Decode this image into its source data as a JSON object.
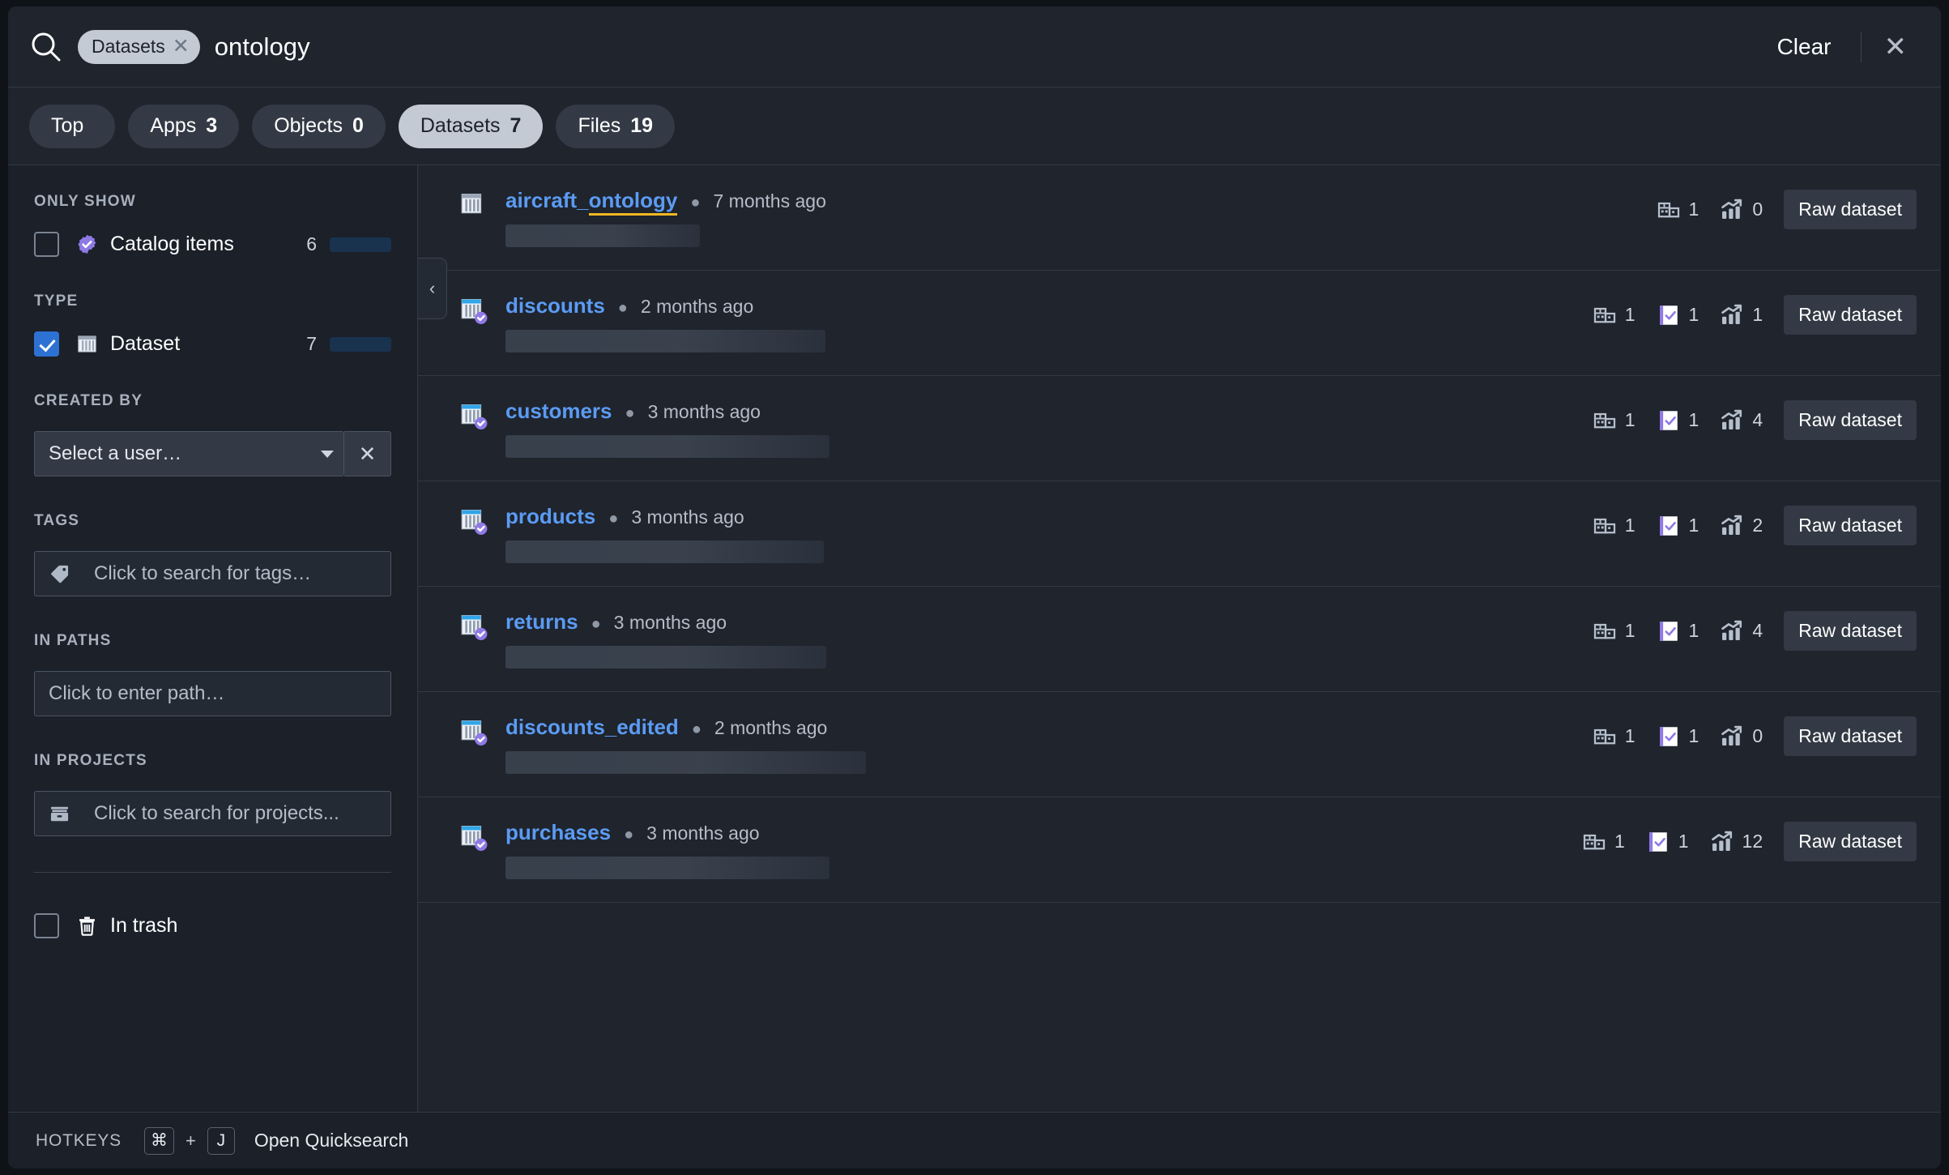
{
  "search": {
    "scope_chip": "Datasets",
    "query": "ontology",
    "clear_label": "Clear",
    "close_label": "✕"
  },
  "tabs": [
    {
      "label": "Top",
      "count": "",
      "active": false
    },
    {
      "label": "Apps",
      "count": "3",
      "active": false
    },
    {
      "label": "Objects",
      "count": "0",
      "active": false
    },
    {
      "label": "Datasets",
      "count": "7",
      "active": true
    },
    {
      "label": "Files",
      "count": "19",
      "active": false
    }
  ],
  "sidebar": {
    "only_show_label": "ONLY SHOW",
    "only_show": {
      "name": "Catalog items",
      "count": "6",
      "bar_pct": 86,
      "checked": false,
      "icon": "catalog-check-icon"
    },
    "type_label": "TYPE",
    "type": {
      "name": "Dataset",
      "count": "7",
      "bar_pct": 100,
      "checked": true,
      "icon": "dataset-icon"
    },
    "created_by_label": "CREATED BY",
    "created_by_placeholder": "Select a user…",
    "tags_label": "TAGS",
    "tags_placeholder": "Click to search for tags…",
    "in_paths_label": "IN PATHS",
    "in_paths_placeholder": "Click to enter path…",
    "in_projects_label": "IN PROJECTS",
    "in_projects_placeholder": "Click to search for projects...",
    "in_trash_label": "In trash",
    "in_trash_checked": false,
    "collapse_glyph": "‹"
  },
  "results": [
    {
      "title": "aircraft_",
      "title_highlight": "ontology",
      "time": "7 months ago",
      "verified": false,
      "skeleton_width": 240,
      "org_count": "1",
      "checks_count": null,
      "charts_count": "0",
      "raw_label": "Raw dataset"
    },
    {
      "title": "discounts",
      "title_highlight": "",
      "time": "2 months ago",
      "verified": true,
      "skeleton_width": 395,
      "org_count": "1",
      "checks_count": "1",
      "charts_count": "1",
      "raw_label": "Raw dataset"
    },
    {
      "title": "customers",
      "title_highlight": "",
      "time": "3 months ago",
      "verified": true,
      "skeleton_width": 400,
      "org_count": "1",
      "checks_count": "1",
      "charts_count": "4",
      "raw_label": "Raw dataset"
    },
    {
      "title": "products",
      "title_highlight": "",
      "time": "3 months ago",
      "verified": true,
      "skeleton_width": 393,
      "org_count": "1",
      "checks_count": "1",
      "charts_count": "2",
      "raw_label": "Raw dataset"
    },
    {
      "title": "returns",
      "title_highlight": "",
      "time": "3 months ago",
      "verified": true,
      "skeleton_width": 396,
      "org_count": "1",
      "checks_count": "1",
      "charts_count": "4",
      "raw_label": "Raw dataset"
    },
    {
      "title": "discounts_edited",
      "title_highlight": "",
      "time": "2 months ago",
      "verified": true,
      "skeleton_width": 445,
      "org_count": "1",
      "checks_count": "1",
      "charts_count": "0",
      "raw_label": "Raw dataset"
    },
    {
      "title": "purchases",
      "title_highlight": "",
      "time": "3 months ago",
      "verified": true,
      "skeleton_width": 400,
      "org_count": "1",
      "checks_count": "1",
      "charts_count": "12",
      "raw_label": "Raw dataset"
    }
  ],
  "hotkeys": {
    "label": "HOTKEYS",
    "key1": "⌘",
    "plus": "+",
    "key2": "J",
    "description": "Open Quicksearch"
  },
  "colors": {
    "accent_blue": "#2d72d2",
    "link_blue": "#5b9bf3",
    "highlight_yellow": "#f2b824",
    "verified_purple": "#8f7ae5",
    "panel_bg": "#1f242d",
    "sidebar_bg": "#1b2029"
  }
}
